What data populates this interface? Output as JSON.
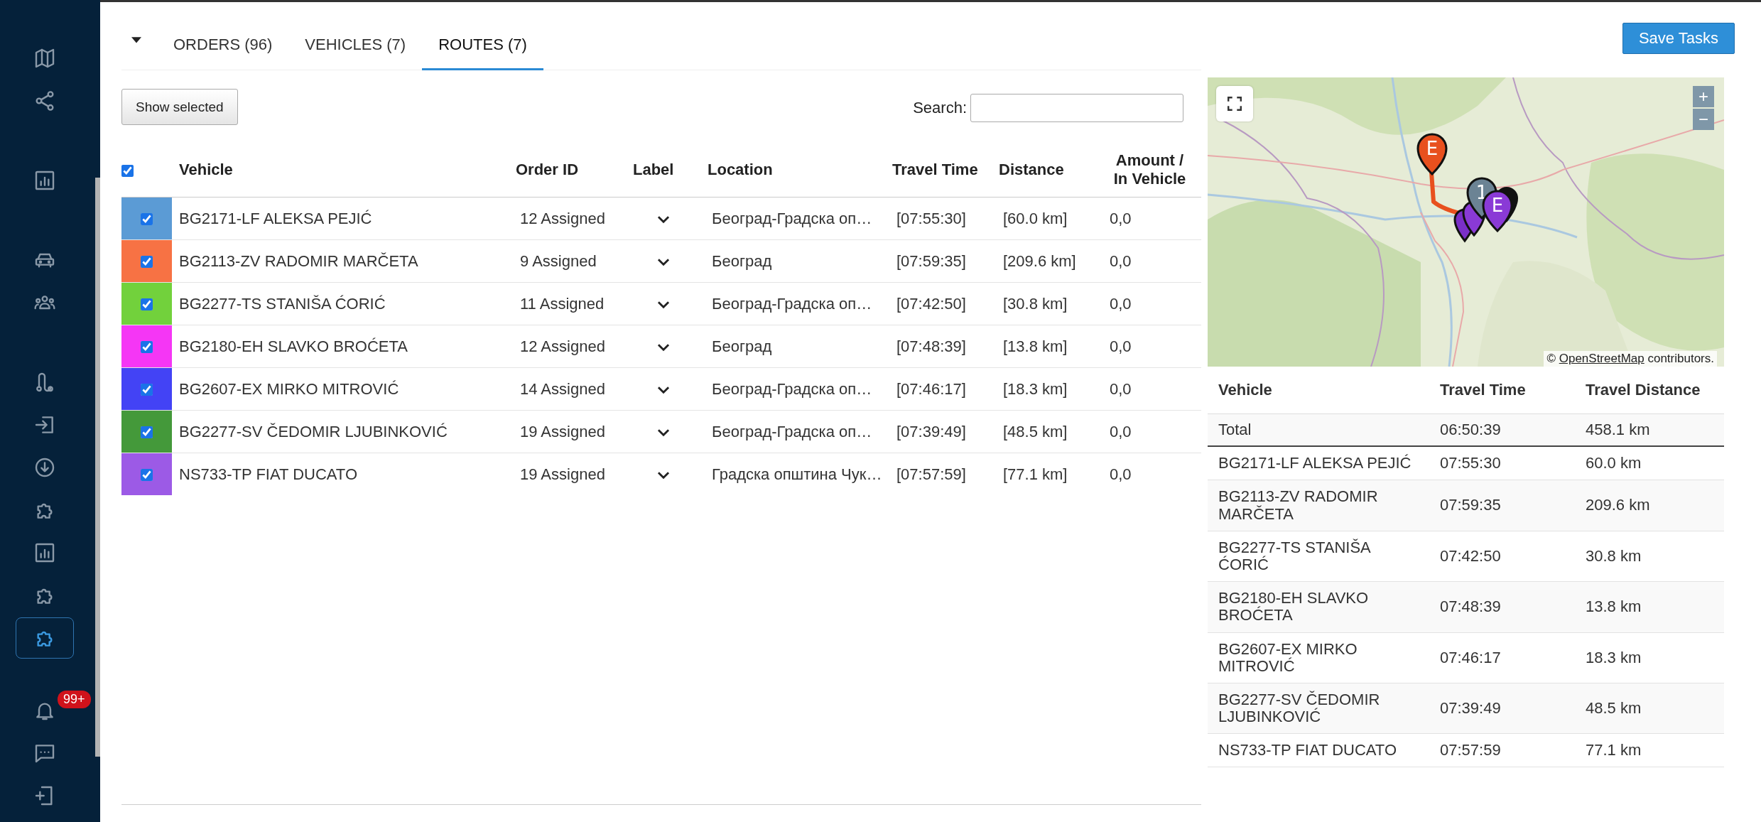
{
  "sidebar": {
    "groups": [
      [
        {
          "selected": false
        },
        {
          "selected": false
        }
      ],
      [
        {
          "selected": false
        }
      ],
      [
        {
          "selected": false
        },
        {
          "selected": false
        }
      ],
      [
        {
          "selected": false
        },
        {
          "selected": false
        },
        {
          "selected": false
        },
        {
          "selected": false
        },
        {
          "selected": false
        },
        {
          "selected": false
        },
        {
          "selected": true
        }
      ],
      [
        {
          "selected": false,
          "badge": "99+"
        },
        {
          "selected": false
        },
        {
          "selected": false
        }
      ]
    ]
  },
  "tabs": [
    {
      "label": "ORDERS (96)",
      "selected": false
    },
    {
      "label": "VEHICLES (7)",
      "selected": false
    },
    {
      "label": "ROUTES (7)",
      "selected": true
    }
  ],
  "save_button": "Save Tasks",
  "toolbar": {
    "show_selected": "Show selected",
    "search_label": "Search:"
  },
  "routes_table": {
    "all_checked": true,
    "columns": [
      "Vehicle",
      "Order ID",
      "Label",
      "Location",
      "Travel Time",
      "Distance",
      "Amount / In Vehicle"
    ],
    "rows": [
      {
        "color": "#5b9bd5",
        "checked": true,
        "vehicle": "BG2171-LF ALEKSA PEJIĆ",
        "order_id": "12 Assigned",
        "location": "Београд-Градска оп…",
        "travel_time": "[07:55:30]",
        "distance": "[60.0 km]",
        "amount": "0,0"
      },
      {
        "color": "#f77244",
        "checked": true,
        "vehicle": "BG2113-ZV RADOMIR MARČETA",
        "order_id": "9 Assigned",
        "location": "Београд",
        "travel_time": "[07:59:35]",
        "distance": "[209.6 km]",
        "amount": "0,0"
      },
      {
        "color": "#72d13c",
        "checked": true,
        "vehicle": "BG2277-TS STANIŠA ĆORIĆ",
        "order_id": "11 Assigned",
        "location": "Београд-Градска оп…",
        "travel_time": "[07:42:50]",
        "distance": "[30.8 km]",
        "amount": "0,0"
      },
      {
        "color": "#f536f5",
        "checked": true,
        "vehicle": "BG2180-EH SLAVKO BROĆETA",
        "order_id": "12 Assigned",
        "location": "Београд",
        "travel_time": "[07:48:39]",
        "distance": "[13.8 km]",
        "amount": "0,0"
      },
      {
        "color": "#4343f5",
        "checked": true,
        "vehicle": "BG2607-EX MIRKO MITROVIĆ",
        "order_id": "14 Assigned",
        "location": "Београд-Градска оп…",
        "travel_time": "[07:46:17]",
        "distance": "[18.3 km]",
        "amount": "0,0"
      },
      {
        "color": "#44993a",
        "checked": true,
        "vehicle": "BG2277-SV ČEDOMIR LJUBINKOVIĆ",
        "order_id": "19 Assigned",
        "location": "Београд-Градска оп…",
        "travel_time": "[07:39:49]",
        "distance": "[48.5 km]",
        "amount": "0,0"
      },
      {
        "color": "#9c5ae6",
        "checked": true,
        "vehicle": "NS733-TP FIAT DUCATO",
        "order_id": "19 Assigned",
        "location": "Градска општина Чук…",
        "travel_time": "[07:57:59]",
        "distance": "[77.1 km]",
        "amount": "0,0"
      }
    ]
  },
  "map": {
    "kind": "picture",
    "zoom_in": "+",
    "zoom_out": "−",
    "markers": [
      {
        "label": "E",
        "color": "#e8501e"
      },
      {
        "label": "1",
        "color": "#6b8394"
      },
      {
        "label": "E",
        "color": "#8a3ad6"
      }
    ],
    "attribution": {
      "prefix": "©",
      "link": "OpenStreetMap",
      "suffix": "contributors."
    }
  },
  "summary_table": {
    "columns": [
      "Vehicle",
      "Travel Time",
      "Travel Distance"
    ],
    "total": {
      "vehicle": "Total",
      "travel_time": "06:50:39",
      "travel_distance": "458.1 km"
    },
    "rows": [
      {
        "vehicle": "BG2171-LF ALEKSA PEJIĆ",
        "travel_time": "07:55:30",
        "travel_distance": "60.0 km"
      },
      {
        "vehicle": "BG2113-ZV RADOMIR MARČETA",
        "travel_time": "07:59:35",
        "travel_distance": "209.6 km"
      },
      {
        "vehicle": "BG2277-TS STANIŠA ĆORIĆ",
        "travel_time": "07:42:50",
        "travel_distance": "30.8 km"
      },
      {
        "vehicle": "BG2180-EH SLAVKO BROĆETA",
        "travel_time": "07:48:39",
        "travel_distance": "13.8 km"
      },
      {
        "vehicle": "BG2607-EX MIRKO MITROVIĆ",
        "travel_time": "07:46:17",
        "travel_distance": "18.3 km"
      },
      {
        "vehicle": "BG2277-SV ČEDOMIR LJUBINKOVIĆ",
        "travel_time": "07:39:49",
        "travel_distance": "48.5 km"
      },
      {
        "vehicle": "NS733-TP FIAT DUCATO",
        "travel_time": "07:57:59",
        "travel_distance": "77.1 km"
      }
    ]
  }
}
